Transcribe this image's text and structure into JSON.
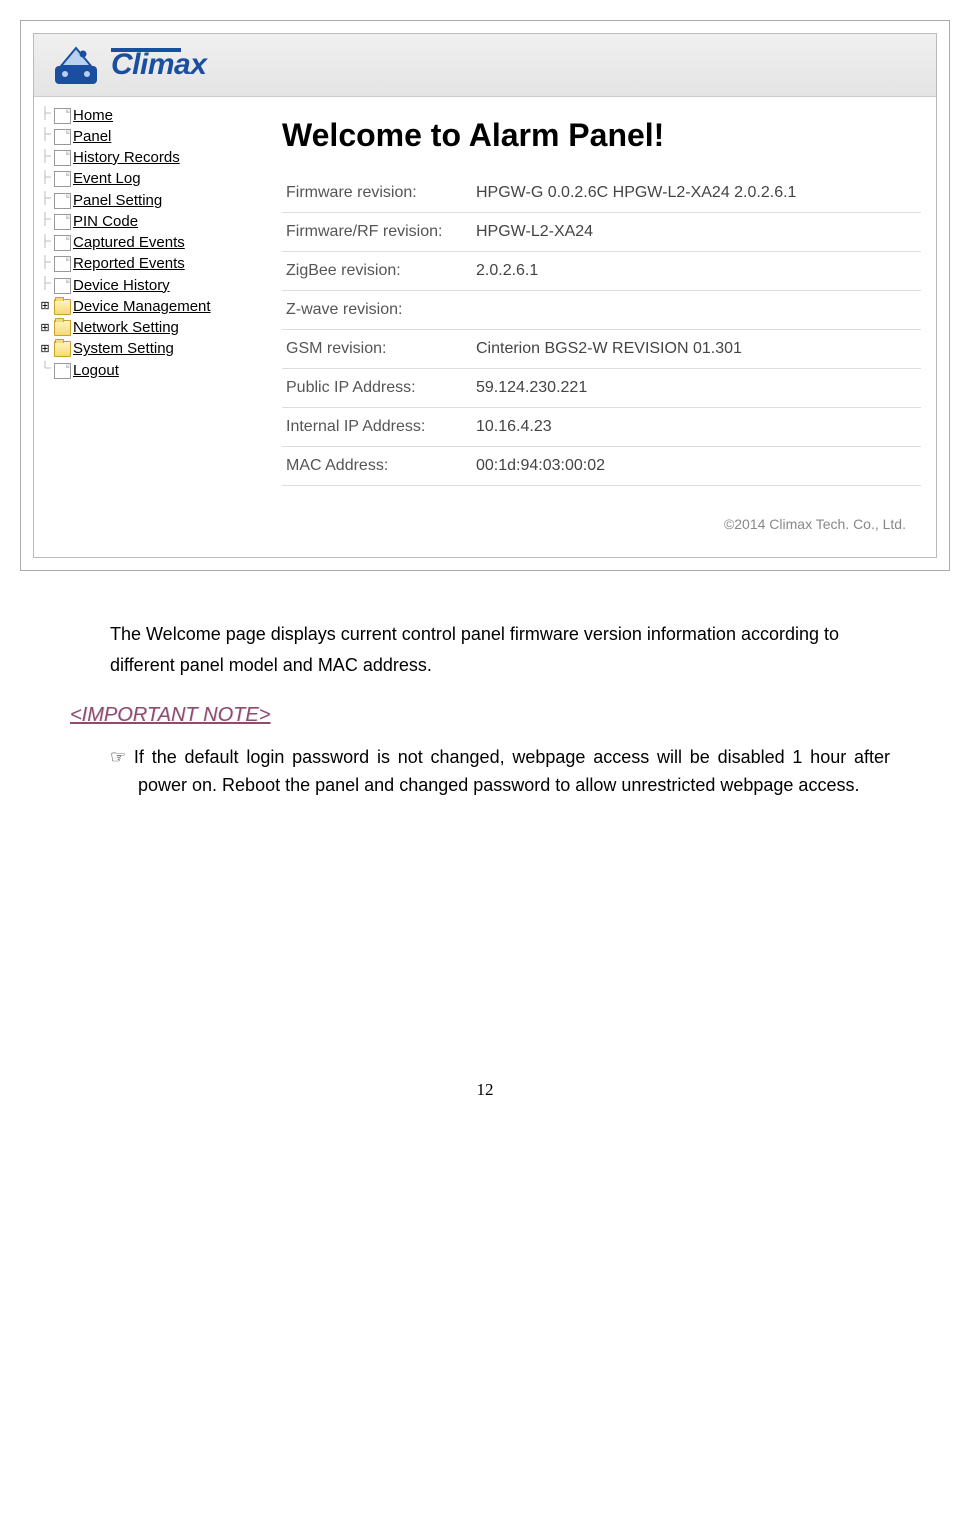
{
  "brand": "Climax",
  "sidebar": {
    "items": [
      {
        "label": "Home",
        "icon": "page",
        "toggle": "dash"
      },
      {
        "label": "Panel",
        "icon": "page",
        "toggle": "dash"
      },
      {
        "label": "History Records",
        "icon": "page",
        "toggle": "dash"
      },
      {
        "label": "Event Log",
        "icon": "page",
        "toggle": "dash"
      },
      {
        "label": "Panel Setting",
        "icon": "page",
        "toggle": "dash"
      },
      {
        "label": "PIN Code",
        "icon": "page",
        "toggle": "dash"
      },
      {
        "label": "Captured Events",
        "icon": "page",
        "toggle": "dash"
      },
      {
        "label": "Reported Events",
        "icon": "page",
        "toggle": "dash"
      },
      {
        "label": "Device History",
        "icon": "page",
        "toggle": "dash"
      },
      {
        "label": "Device Management",
        "icon": "folder",
        "toggle": "plus"
      },
      {
        "label": "Network Setting",
        "icon": "folder",
        "toggle": "plus"
      },
      {
        "label": "System Setting",
        "icon": "folder",
        "toggle": "plus"
      },
      {
        "label": "Logout",
        "icon": "page",
        "toggle": "dash"
      }
    ]
  },
  "main": {
    "title": "Welcome to Alarm Panel!",
    "rows": [
      {
        "label": "Firmware revision:",
        "value": "HPGW-G 0.0.2.6C HPGW-L2-XA24 2.0.2.6.1"
      },
      {
        "label": "Firmware/RF revision:",
        "value": "HPGW-L2-XA24"
      },
      {
        "label": "ZigBee revision:",
        "value": "2.0.2.6.1"
      },
      {
        "label": "Z-wave revision:",
        "value": ""
      },
      {
        "label": "GSM revision:",
        "value": "Cinterion BGS2-W REVISION 01.301"
      },
      {
        "label": "Public IP Address:",
        "value": "59.124.230.221"
      },
      {
        "label": "Internal IP Address:",
        "value": "10.16.4.23"
      },
      {
        "label": "MAC Address:",
        "value": "00:1d:94:03:00:02"
      }
    ],
    "copyright": "©2014 Climax Tech. Co., Ltd."
  },
  "doc": {
    "para1": "The Welcome page displays current control panel firmware version information according to different panel model and MAC address.",
    "noteHeading": "<IMPORTANT NOTE>",
    "noteBody": "If the default login password is not changed, webpage access will be disabled 1 hour after power on. Reboot the panel and changed password to allow unrestricted webpage access.",
    "pageNumber": "12"
  }
}
